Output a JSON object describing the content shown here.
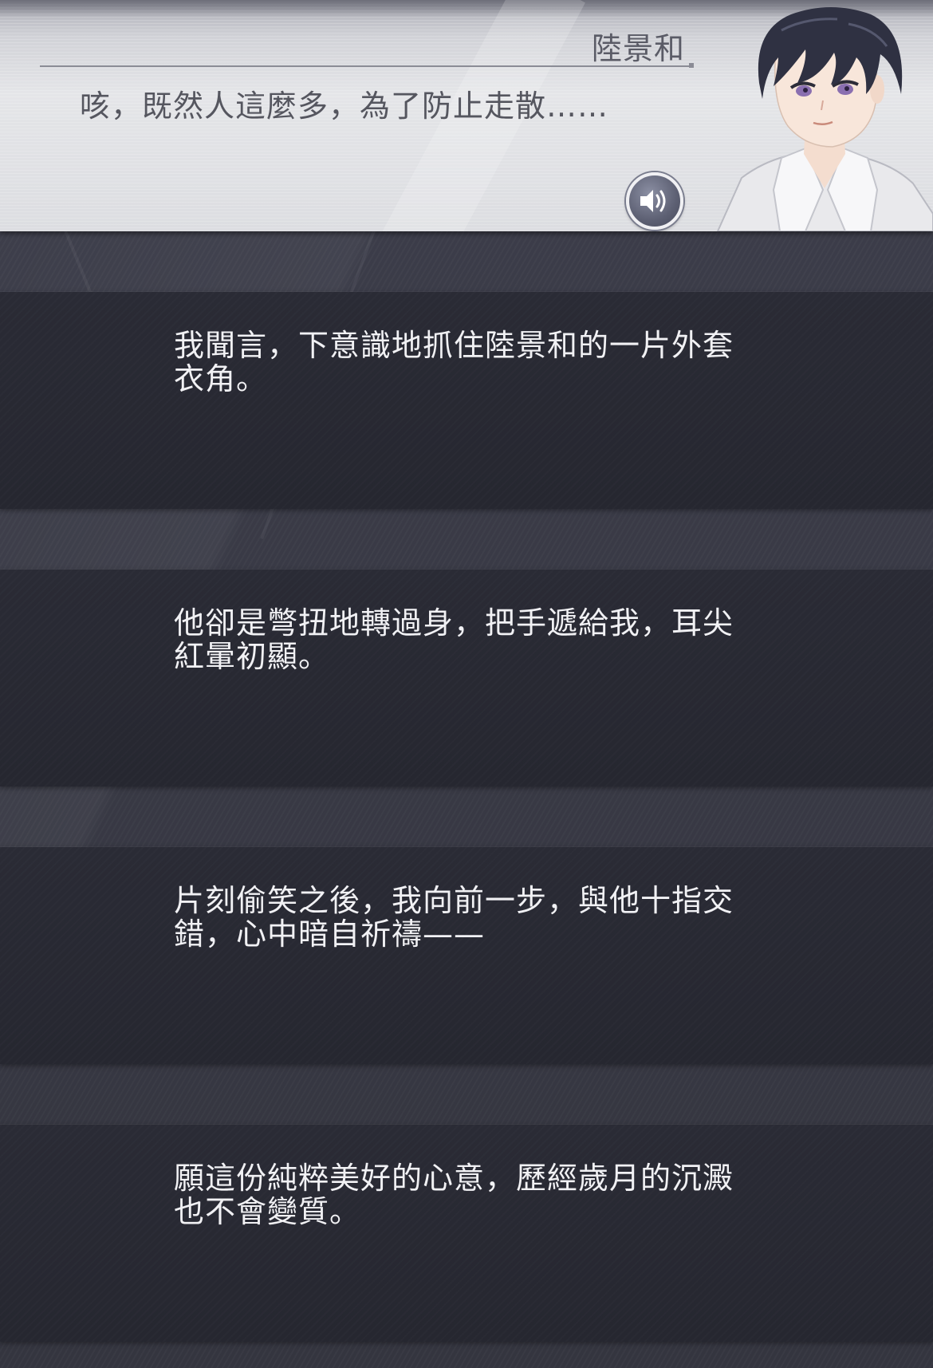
{
  "dialogue": {
    "speaker": "陸景和",
    "text": "咳，既然人這麼多，為了防止走散……",
    "voice_icon": "speaker-volume-icon"
  },
  "narration": [
    {
      "line1": "我聞言，下意識地抓住陸景和的一片外套",
      "line2": "衣角。"
    },
    {
      "line1": "他卻是彆扭地轉過身，把手遞給我，耳尖",
      "line2": "紅暈初顯。"
    },
    {
      "line1": "片刻偷笑之後，我向前一步，與他十指交",
      "line2": "錯，心中暗自祈禱——"
    },
    {
      "line1": "願這份純粹美好的心意，歷經歲月的沉澱",
      "line2": "也不會變質。"
    }
  ],
  "colors": {
    "panel_bg": "#282933",
    "page_bg": "#3b3c48",
    "dialogue_bg": "#e0e1e5",
    "text_light": "#f1f1f4",
    "text_dark": "#55565f"
  }
}
